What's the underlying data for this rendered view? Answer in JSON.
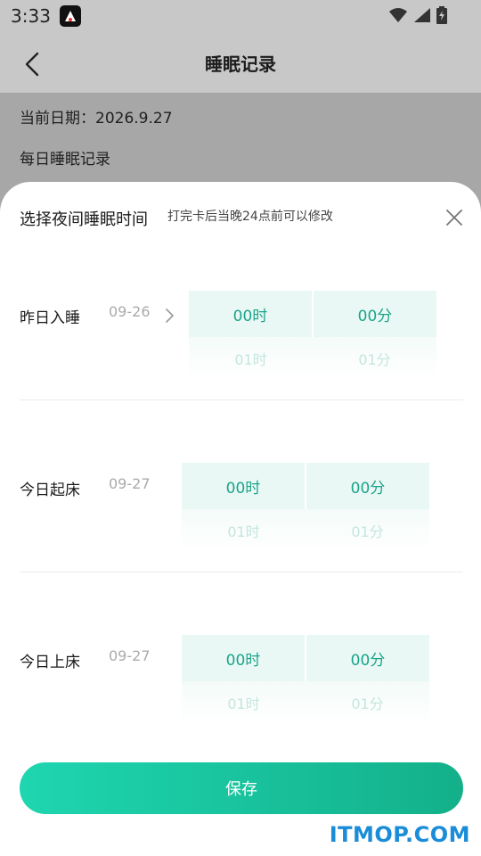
{
  "status_bar": {
    "time": "3:33"
  },
  "header": {
    "title": "睡眠记录"
  },
  "background": {
    "current_date": "当前日期：2026.9.27",
    "section": "每日睡眠记录"
  },
  "sheet": {
    "title": "选择夜间睡眠时间",
    "subtitle": "打完卡后当晚24点前可以修改",
    "rows": [
      {
        "label": "昨日入睡",
        "date": "09-26",
        "hour": "00时",
        "minute": "00分",
        "next_hour": "01时",
        "next_minute": "01分"
      },
      {
        "label": "今日起床",
        "date": "09-27",
        "hour": "00时",
        "minute": "00分",
        "next_hour": "01时",
        "next_minute": "01分"
      },
      {
        "label": "今日上床",
        "date": "09-27",
        "hour": "00时",
        "minute": "00分",
        "next_hour": "01时",
        "next_minute": "01分"
      }
    ],
    "save_label": "保存"
  },
  "watermark": "ITMOP.COM",
  "colors": {
    "accent": "#1aa48a",
    "button_start": "#1ed6b0",
    "button_end": "#13b08a"
  }
}
